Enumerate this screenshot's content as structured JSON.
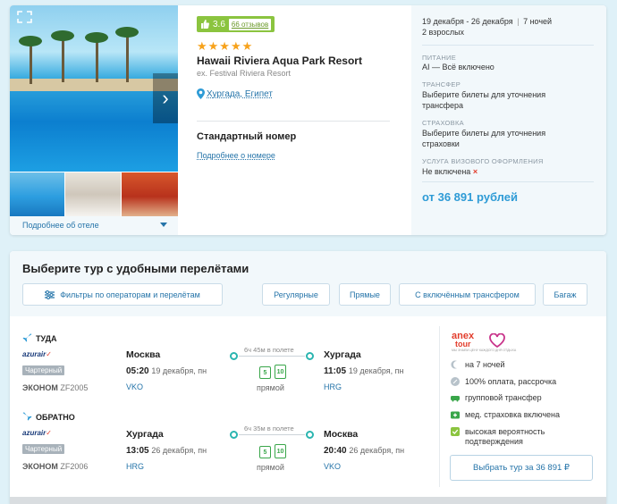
{
  "hotel": {
    "rating": "3.6",
    "reviews": "66 отзывов",
    "stars": "★★★★★",
    "name": "Hawaii Riviera Aqua Park Resort",
    "ex_name": "ex. Festival Riviera Resort",
    "location": "Хургада, Египет",
    "room_title": "Стандартный номер",
    "room_more": "Подробнее о номере",
    "more_hotel": "Подробнее об отеле"
  },
  "summary": {
    "dates": "19 декабря - 26 декабря",
    "nights": "7 ночей",
    "guests": "2 взрослых",
    "food_label": "ПИТАНИЕ",
    "food_value": "AI — Всё включено",
    "transfer_label": "ТРАНСФЕР",
    "transfer_value": "Выберите билеты для уточнения трансфера",
    "insurance_label": "СТРАХОВКА",
    "insurance_value": "Выберите билеты для уточнения страховки",
    "visa_label": "УСЛУГА ВИЗОВОГО ОФОРМЛЕНИЯ",
    "visa_value": "Не включена",
    "visa_mark": "×",
    "price": "от 36 891 рублей"
  },
  "tour_section": {
    "title": "Выберите тур с удобными перелётами",
    "filters_button": "Фильтры по операторам и перелётам",
    "chips": [
      "Регулярные",
      "Прямые",
      "С включённым трансфером",
      "Багаж"
    ]
  },
  "outbound": {
    "label": "ТУДА",
    "airline": "azurair",
    "charter": "Чартерный",
    "class": "ЭКОНОМ",
    "flight": "ZF2005",
    "from_city": "Москва",
    "dep_time": "05:20",
    "dep_date": "19 декабря, пн",
    "from_code": "VKO",
    "duration": "6ч 45м в полете",
    "bag1": "5",
    "bag2": "10",
    "direct": "прямой",
    "to_city": "Хургада",
    "arr_time": "11:05",
    "arr_date": "19 декабря, пн",
    "to_code": "HRG"
  },
  "return": {
    "label": "ОБРАТНО",
    "airline": "azurair",
    "charter": "Чартерный",
    "class": "ЭКОНОМ",
    "flight": "ZF2006",
    "from_city": "Хургада",
    "dep_time": "13:05",
    "dep_date": "26 декабря, пн",
    "from_code": "HRG",
    "duration": "6ч 35м в полете",
    "bag1": "5",
    "bag2": "10",
    "direct": "прямой",
    "to_city": "Москва",
    "arr_time": "20:40",
    "arr_date": "26 декабря, пн",
    "to_code": "VKO"
  },
  "operator": {
    "logo_top": "anex",
    "logo_bottom": "tour",
    "logo_slogan": "МЫ ЗНАЕМ ЦЕНУ КАЖДОГО ДНЯ ОТДЫХА",
    "features": [
      "на 7 ночей",
      "100% оплата, рассрочка",
      "групповой трансфер",
      "мед. страховка включена",
      "высокая вероятность подтверждения"
    ],
    "choose_button": "Выбрать тур за 36 891 ₽"
  },
  "colors": {
    "accent": "#2574a9",
    "price": "#2e9bd6",
    "rating": "#8bc43f",
    "star": "#f7a21b",
    "teal": "#2bb5b0",
    "green": "#39a64a"
  }
}
